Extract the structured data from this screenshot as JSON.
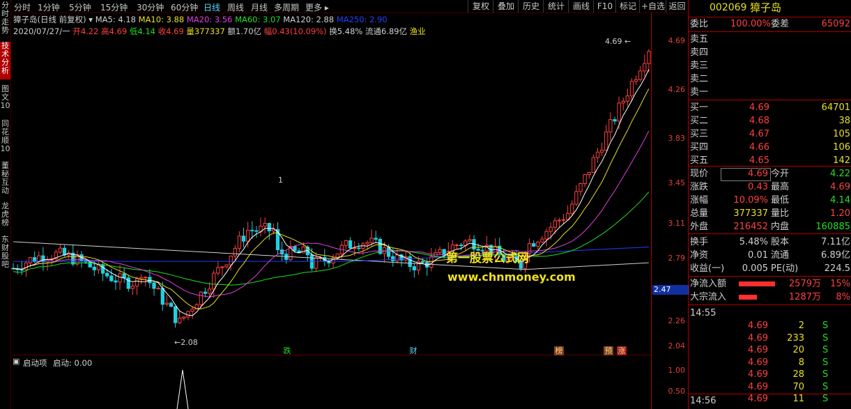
{
  "left_tabs": [
    "分时走势",
    "技术分析",
    "图文10",
    "同花顺10",
    "董秘互动",
    "龙虎榜",
    "东财股吧"
  ],
  "topbar": {
    "periods": [
      "分时",
      "1分钟",
      "5分钟",
      "15分钟",
      "30分钟",
      "60分钟",
      "日线",
      "周线",
      "月线",
      "多周期",
      "更多"
    ],
    "selected": "日线",
    "buttons": [
      "复权",
      "叠加",
      "历史",
      "统计",
      "画线",
      "F10",
      "标记",
      "+自选",
      "返回"
    ]
  },
  "ma_line": {
    "title": "獐子岛(日线 前复权)",
    "ma5": "MA5: 4.18",
    "ma10": "MA10: 3.88",
    "ma20": "MA20: 3.56",
    "ma60": "MA60: 3.07",
    "ma120": "MA120: 2.88",
    "ma250": "MA250: 2.90"
  },
  "bar_info": {
    "date": "2020/07/27/一",
    "open": "开4.22",
    "high": "高4.69",
    "low": "低4.14",
    "close": "收4.69",
    "vol": "量377337",
    "amt": "额1.70亿",
    "chg": "幅0.43(10.09%)",
    "turn": "换5.48%",
    "float": "流通6.89亿",
    "industry": "渔业"
  },
  "annotations": {
    "high_label": "4.69",
    "low_label": "2.08",
    "mark1": "1",
    "tag_die": "跌",
    "tag_cai": "财",
    "tag_bang": "榜",
    "tag_yu": "预",
    "tag_zhang": "涨"
  },
  "watermark": {
    "line1": "第一股票公式网",
    "line2": "www.chnmoney.com"
  },
  "yaxis": {
    "labels": [
      "4.69",
      "4.26",
      "3.83",
      "3.45",
      "3.11",
      "2.79",
      "2.47",
      "2.26",
      "2.04"
    ],
    "current": "2.47",
    "sub_labels": [
      "1.00",
      "0.50"
    ]
  },
  "indicator": {
    "name": "启动项",
    "value": "启动: 0.00"
  },
  "quote": {
    "code": "002069",
    "name": "獐子岛",
    "weibi_label": "委比",
    "weibi": "100.00%",
    "weicha_label": "委差",
    "weicha": "65092",
    "sells": [
      {
        "label": "卖五"
      },
      {
        "label": "卖四"
      },
      {
        "label": "卖三"
      },
      {
        "label": "卖二"
      },
      {
        "label": "卖一"
      }
    ],
    "buys": [
      {
        "label": "买一",
        "price": "4.69",
        "vol": "64701"
      },
      {
        "label": "买二",
        "price": "4.68",
        "vol": "38"
      },
      {
        "label": "买三",
        "price": "4.67",
        "vol": "105"
      },
      {
        "label": "买四",
        "price": "4.66",
        "vol": "106"
      },
      {
        "label": "买五",
        "price": "4.65",
        "vol": "142"
      }
    ],
    "stats": [
      {
        "l1": "现价",
        "v1": "4.69",
        "l2": "今开",
        "v2": "4.22"
      },
      {
        "l1": "涨跌",
        "v1": "0.43",
        "l2": "最高",
        "v2": "4.69"
      },
      {
        "l1": "涨幅",
        "v1": "10.09%",
        "l2": "最低",
        "v2": "4.14"
      },
      {
        "l1": "总量",
        "v1": "377337",
        "l2": "量比",
        "v2": "1.20"
      },
      {
        "l1": "外盘",
        "v1": "216452",
        "l2": "内盘",
        "v2": "160885"
      }
    ],
    "stats2": [
      {
        "l1": "换手",
        "v1": "5.48%",
        "l2": "股本",
        "v2": "7.11亿"
      },
      {
        "l1": "净资",
        "v1": "0.01",
        "l2": "流通",
        "v2": "6.89亿"
      },
      {
        "l1": "收益(一)",
        "v1": "0.005",
        "l2": "PE(动)",
        "v2": "224.5"
      }
    ],
    "flows": [
      {
        "label": "净流入额",
        "value": "2579万",
        "pct": "15%"
      },
      {
        "label": "大宗流入",
        "value": "1287万",
        "pct": "8%"
      }
    ],
    "ticks_time": "14:55",
    "ticks": [
      {
        "price": "4.69",
        "vol": "2",
        "side": "S"
      },
      {
        "price": "4.69",
        "vol": "233",
        "side": "S"
      },
      {
        "price": "4.69",
        "vol": "20",
        "side": "S"
      },
      {
        "price": "4.69",
        "vol": "8",
        "side": "S"
      },
      {
        "price": "4.69",
        "vol": "28",
        "side": "S"
      },
      {
        "price": "4.69",
        "vol": "70",
        "side": "S"
      },
      {
        "price": "4.69",
        "vol": "11",
        "side": "S"
      }
    ],
    "ticks_time2": "14:56"
  },
  "colors": {
    "up": "#ff4040",
    "down": "#20d0e0",
    "ma5": "#ffffff",
    "ma10": "#e8e020",
    "ma20": "#e040e0",
    "ma60": "#20e020",
    "ma120": "#d0d0d0",
    "ma250": "#2040ff"
  }
}
